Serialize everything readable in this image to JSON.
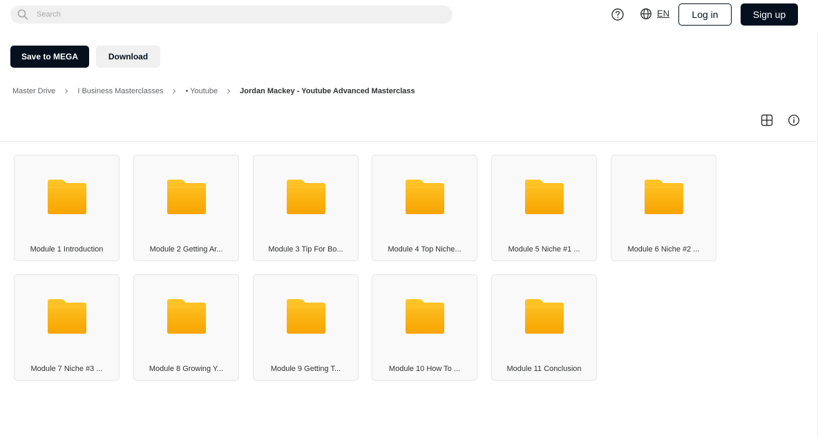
{
  "header": {
    "search_placeholder": "Search",
    "language": "EN",
    "login_label": "Log in",
    "signup_label": "Sign up"
  },
  "actions": {
    "save_label": "Save to MEGA",
    "download_label": "Download"
  },
  "breadcrumb": [
    {
      "label": "Master Drive"
    },
    {
      "label": "I Business Masterclasses"
    },
    {
      "label": "• Youtube"
    },
    {
      "label": "Jordan Mackey - Youtube Advanced Masterclass"
    }
  ],
  "folders": [
    {
      "name": "Module 1 Introduction"
    },
    {
      "name": "Module 2 Getting Ar..."
    },
    {
      "name": "Module 3 Tip For Bo..."
    },
    {
      "name": "Module 4 Top Niche..."
    },
    {
      "name": "Module 5 Niche #1 ..."
    },
    {
      "name": "Module 6 Niche #2 ..."
    },
    {
      "name": "Module 7 Niche #3 ..."
    },
    {
      "name": "Module 8 Growing Y..."
    },
    {
      "name": "Module 9 Getting T..."
    },
    {
      "name": "Module 10 How To ..."
    },
    {
      "name": "Module 11 Conclusion"
    }
  ],
  "colors": {
    "primary_dark": "#04101e",
    "folder_top": "#ffc629",
    "folder_bottom": "#f7a400"
  },
  "icons": [
    "search-icon",
    "help-icon",
    "globe-icon",
    "chevron-right-icon",
    "grid-view-icon",
    "info-icon",
    "folder-icon"
  ]
}
